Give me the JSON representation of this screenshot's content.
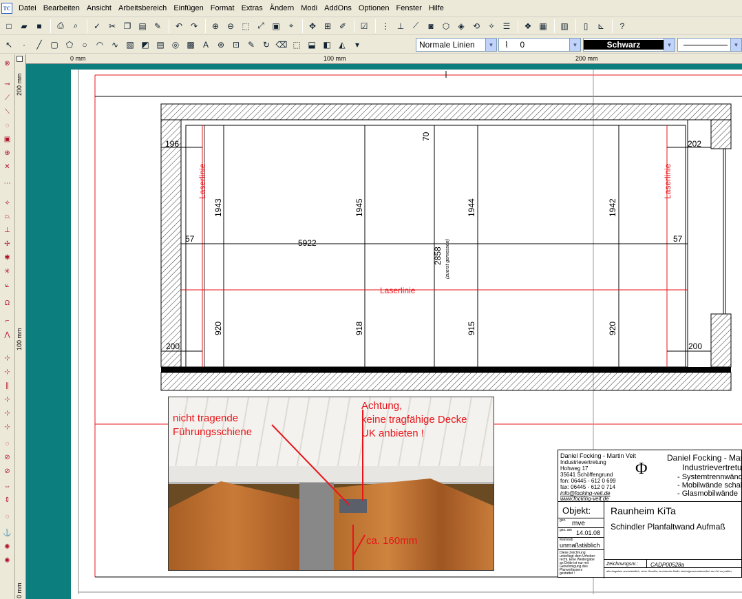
{
  "menubar": {
    "app_icon_text": "TC",
    "items": [
      "Datei",
      "Bearbeiten",
      "Ansicht",
      "Arbeitsbereich",
      "Einfügen",
      "Format",
      "Extras",
      "Ändern",
      "Modi",
      "AddOns",
      "Optionen",
      "Fenster",
      "Hilfe"
    ]
  },
  "toolbar2": {
    "line_style": "Normale Linien",
    "line_width": "0",
    "color": "Schwarz"
  },
  "rulers": {
    "h_labels": [
      "0 mm",
      "100 mm",
      "200 mm"
    ],
    "v_labels": [
      "200 mm",
      "100 mm",
      "0 mm"
    ]
  },
  "drawing": {
    "dim_left_top": "196",
    "dim_right_top": "202",
    "dim_top_gap": "70",
    "laser_left": "Laserlinie",
    "laser_right": "Laserlinie",
    "laser_center": "Laserlinie",
    "heights_top": [
      "1943",
      "1945",
      "1944",
      "1942"
    ],
    "heights_bottom": [
      "920",
      "918",
      "915",
      "920"
    ],
    "dim_left_mid": "57",
    "dim_right_mid": "57",
    "width_total": "5922",
    "height_total": "2858",
    "height_note": "(zuerst gemessen)",
    "dim_left_bottom": "200",
    "dim_right_bottom": "200"
  },
  "photo": {
    "label_rail_1": "nicht tragende",
    "label_rail_2": "Führungsschiene",
    "label_warn_1": "Achtung,",
    "label_warn_2": "keine tragfähige Decke",
    "label_warn_3": "UK anbieten !",
    "label_dim": "ca. 160mm"
  },
  "titleblock": {
    "company_left_1": "Daniel Focking - Martin Veit",
    "company_left_2": "Industrievertretung",
    "company_left_3": "Hohweg 17",
    "company_left_4": "35641 Schöffengrund",
    "company_left_5": "fon: 06445 - 612 0 699",
    "company_left_6": "fax: 06445 - 612 0 714",
    "company_left_7": "info@focking-veit.de",
    "company_left_8": "www.focking-veit.de",
    "company_right_1": "Daniel Focking - Mart",
    "company_right_2": "Industrievertretun",
    "bullet_1": "- Systemtrennwände",
    "bullet_2": "- Mobilwände schalld",
    "bullet_3": "- Glasmobilwände",
    "logo_symbol": "Φ",
    "objekt_label": "Objekt:",
    "objekt_value": "Raunheim KiTa",
    "subject": "Schindler Planfaltwand Aufmaß",
    "gez_label": "gez.",
    "gez_value": "mve",
    "date_label": "gez. am",
    "date_value": "14.01.08",
    "scale_label": "Maßstab",
    "scale_value": "unmaßstäblich",
    "disclaimer_1": "Diese Zeichnung",
    "disclaimer_2": "unterliegt dem Urheber-",
    "disclaimer_3": "recht. Eine Weitergabe",
    "disclaimer_4": "an Dritte ist nur mit",
    "disclaimer_5": "Genehmigung des",
    "disclaimer_6": "Planverfassers",
    "disclaimer_7": "gestattet !",
    "drawing_no_label": "Zeichnungsnr.:",
    "drawing_no_value": "CADP00528a",
    "footnote": "alle Angaben unverbindlich, ohne Gewähr, technische Maße sind eigenverantwortlich am Ort zu prüfen"
  }
}
